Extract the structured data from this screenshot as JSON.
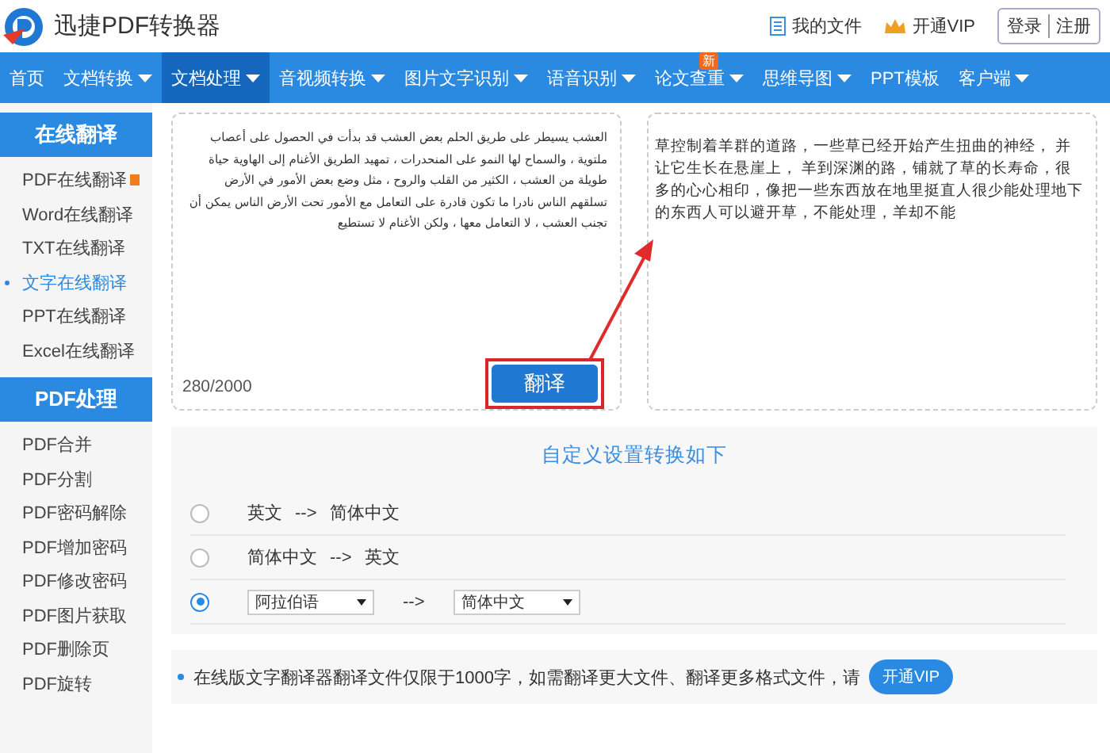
{
  "header": {
    "logo_text": "迅捷PDF转换器",
    "links": [
      {
        "kind": "file",
        "label": "我的文件"
      },
      {
        "kind": "vip",
        "label": "开通VIP"
      }
    ],
    "auth": [
      "登录",
      "注册"
    ]
  },
  "nav": [
    {
      "label": "首页",
      "dropdown": false,
      "selected": false
    },
    {
      "label": "文档转换",
      "dropdown": true,
      "selected": false
    },
    {
      "label": "文档处理",
      "dropdown": true,
      "selected": true
    },
    {
      "label": "音视频转换",
      "dropdown": true,
      "selected": false
    },
    {
      "label": "图片文字识别",
      "dropdown": true,
      "selected": false
    },
    {
      "label": "语音识别",
      "dropdown": true,
      "selected": false
    },
    {
      "label": "论文查重",
      "dropdown": true,
      "selected": false,
      "badge": "新"
    },
    {
      "label": "思维导图",
      "dropdown": true,
      "selected": false
    },
    {
      "label": "PPT模板",
      "dropdown": false,
      "selected": false
    },
    {
      "label": "客户端",
      "dropdown": true,
      "selected": false
    }
  ],
  "sidebar": [
    {
      "title": "在线翻译",
      "items": [
        {
          "label": "PDF在线翻译",
          "selected": false,
          "flagged": true
        },
        {
          "label": "Word在线翻译",
          "selected": false,
          "flagged": false
        },
        {
          "label": "TXT在线翻译",
          "selected": false,
          "flagged": false
        },
        {
          "label": "文字在线翻译",
          "selected": true,
          "flagged": false
        },
        {
          "label": "PPT在线翻译",
          "selected": false,
          "flagged": false
        },
        {
          "label": "Excel在线翻译",
          "selected": false,
          "flagged": false
        }
      ]
    },
    {
      "title": "PDF处理",
      "items": [
        {
          "label": "PDF合并",
          "selected": false,
          "flagged": false
        },
        {
          "label": "PDF分割",
          "selected": false,
          "flagged": false
        },
        {
          "label": "PDF密码解除",
          "selected": false,
          "flagged": false
        },
        {
          "label": "PDF增加密码",
          "selected": false,
          "flagged": false
        },
        {
          "label": "PDF修改密码",
          "selected": false,
          "flagged": false
        },
        {
          "label": "PDF图片获取",
          "selected": false,
          "flagged": false
        },
        {
          "label": "PDF删除页",
          "selected": false,
          "flagged": false
        },
        {
          "label": "PDF旋转",
          "selected": false,
          "flagged": false
        }
      ]
    }
  ],
  "source": {
    "text": "العشب يسيطر على طريق الحلم بعض العشب قد بدأت في الحصول على أعصاب ملتوية ، والسماح لها النمو على المنحدرات ، تمهيد الطريق الأغنام إلى الهاوية حياة طويلة من العشب ، الكثير من القلب والروح ، مثل وضع بعض الأمور في الأرض تسلقهم الناس نادرا ما تكون قادرة على التعامل مع الأمور تحت الأرض الناس يمكن أن تجنب العشب ، لا التعامل معها ، ولكن الأغنام لا تستطيع",
    "count": "280/2000"
  },
  "translate_button": "翻译",
  "result": {
    "text": "草控制着羊群的道路，一些草已经开始产生扭曲的神经， 并让它生长在悬崖上， 羊到深渊的路，铺就了草的长寿命，很多的心心相印，像把一些东西放在地里挺直人很少能处理地下的东西人可以避开草，不能处理，羊却不能"
  },
  "settings": {
    "title": "自定义设置转换如下",
    "options": [
      {
        "kind": "text",
        "from": "英文",
        "arrow": "-->",
        "to": "简体中文",
        "selected": false
      },
      {
        "kind": "text",
        "from": "简体中文",
        "arrow": "-->",
        "to": "英文",
        "selected": false
      },
      {
        "kind": "select",
        "from": "阿拉伯语",
        "arrow": "-->",
        "to": "简体中文",
        "selected": true
      }
    ]
  },
  "notice": {
    "text": "在线版文字翻译器翻译文件仅限于1000字，如需翻译更大文件、翻译更多格式文件，请",
    "button": "开通VIP"
  }
}
